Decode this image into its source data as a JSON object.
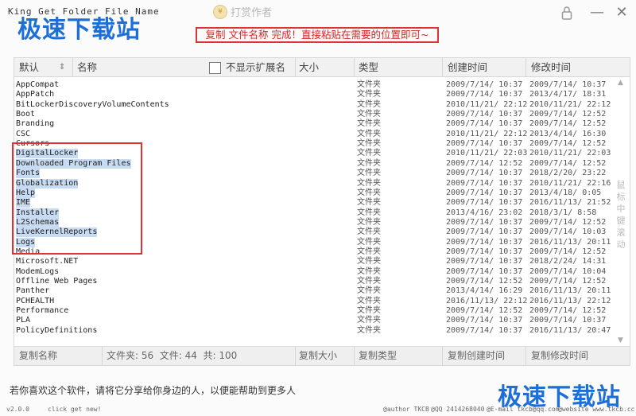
{
  "window": {
    "title": "King Get Folder File Name",
    "reward_label": "打赏作者",
    "watermark": "极速下载站",
    "notice": "复制 文件名称 完成！直接粘贴在需要的位置即可~"
  },
  "header": {
    "sort_label": "默认",
    "sort_icon": "⇕",
    "name": "名称",
    "hide_ext_label": "不显示扩展名",
    "size": "大小",
    "type": "类型",
    "created": "创建时间",
    "modified": "修改时间"
  },
  "rows": [
    {
      "name": "AppCompat",
      "type": "文件夹",
      "created": "2009/7/14/ 10:37",
      "modified": "2009/7/14/ 10:37",
      "selected": false
    },
    {
      "name": "AppPatch",
      "type": "文件夹",
      "created": "2009/7/14/ 10:37",
      "modified": "2013/4/17/ 18:31",
      "selected": false
    },
    {
      "name": "BitLockerDiscoveryVolumeContents",
      "type": "文件夹",
      "created": "2010/11/21/ 22:12",
      "modified": "2010/11/21/ 22:12",
      "selected": false
    },
    {
      "name": "Boot",
      "type": "文件夹",
      "created": "2009/7/14/ 10:37",
      "modified": "2009/7/14/ 12:52",
      "selected": false
    },
    {
      "name": "Branding",
      "type": "文件夹",
      "created": "2009/7/14/ 10:37",
      "modified": "2009/7/14/ 12:52",
      "selected": false
    },
    {
      "name": "CSC",
      "type": "文件夹",
      "created": "2010/11/21/ 22:12",
      "modified": "2013/4/14/ 16:30",
      "selected": false
    },
    {
      "name": "Cursors",
      "type": "文件夹",
      "created": "2009/7/14/ 10:37",
      "modified": "2009/7/14/ 12:52",
      "selected": false
    },
    {
      "name": "DigitalLocker",
      "type": "文件夹",
      "created": "2010/11/21/ 22:03",
      "modified": "2010/11/21/ 22:03",
      "selected": true
    },
    {
      "name": "Downloaded Program Files",
      "type": "文件夹",
      "created": "2009/7/14/ 12:52",
      "modified": "2009/7/14/ 12:52",
      "selected": true
    },
    {
      "name": "Fonts",
      "type": "文件夹",
      "created": "2009/7/14/ 10:37",
      "modified": "2018/2/20/ 23:22",
      "selected": true
    },
    {
      "name": "Globalization",
      "type": "文件夹",
      "created": "2009/7/14/ 10:37",
      "modified": "2010/11/21/ 22:16",
      "selected": true
    },
    {
      "name": "Help",
      "type": "文件夹",
      "created": "2009/7/14/ 10:37",
      "modified": "2013/4/18/ 0:05",
      "selected": true
    },
    {
      "name": "IME",
      "type": "文件夹",
      "created": "2009/7/14/ 10:37",
      "modified": "2016/11/13/ 21:52",
      "selected": true
    },
    {
      "name": "Installer",
      "type": "文件夹",
      "created": "2013/4/16/ 23:02",
      "modified": "2018/3/1/ 8:58",
      "selected": true
    },
    {
      "name": "L2Schemas",
      "type": "文件夹",
      "created": "2009/7/14/ 10:37",
      "modified": "2009/7/14/ 12:52",
      "selected": true
    },
    {
      "name": "LiveKernelReports",
      "type": "文件夹",
      "created": "2009/7/14/ 10:37",
      "modified": "2009/7/14/ 10:03",
      "selected": true
    },
    {
      "name": "Logs",
      "type": "文件夹",
      "created": "2009/7/14/ 10:37",
      "modified": "2016/11/13/ 20:11",
      "selected": true
    },
    {
      "name": "Media",
      "type": "文件夹",
      "created": "2009/7/14/ 10:37",
      "modified": "2009/7/14/ 12:52",
      "selected": false
    },
    {
      "name": "Microsoft.NET",
      "type": "文件夹",
      "created": "2009/7/14/ 10:37",
      "modified": "2018/2/24/ 14:31",
      "selected": false
    },
    {
      "name": "ModemLogs",
      "type": "文件夹",
      "created": "2009/7/14/ 10:37",
      "modified": "2009/7/14/ 10:04",
      "selected": false
    },
    {
      "name": "Offline Web Pages",
      "type": "文件夹",
      "created": "2009/7/14/ 12:52",
      "modified": "2009/7/14/ 12:52",
      "selected": false
    },
    {
      "name": "Panther",
      "type": "文件夹",
      "created": "2013/4/14/ 16:29",
      "modified": "2016/11/13/ 20:11",
      "selected": false
    },
    {
      "name": "PCHEALTH",
      "type": "文件夹",
      "created": "2016/11/13/ 22:12",
      "modified": "2016/11/13/ 22:12",
      "selected": false
    },
    {
      "name": "Performance",
      "type": "文件夹",
      "created": "2009/7/14/ 12:52",
      "modified": "2009/7/14/ 12:52",
      "selected": false
    },
    {
      "name": "PLA",
      "type": "文件夹",
      "created": "2009/7/14/ 10:37",
      "modified": "2009/7/14/ 10:37",
      "selected": false
    },
    {
      "name": "PolicyDefinitions",
      "type": "文件夹",
      "created": "2009/7/14/ 10:37",
      "modified": "2016/11/13/ 20:47",
      "selected": false
    }
  ],
  "scroll_hint": "鼠标中键滚动",
  "footer": {
    "copy_name": "复制名称",
    "folder_count": "文件夹: 56  文件: 44  共: 100",
    "copy_size": "复制大小",
    "copy_type": "复制类型",
    "copy_created": "复制创建时间",
    "copy_modified": "复制修改时间"
  },
  "share_text": "若你喜欢这个软件，请将它分享给你身边的人，以便能帮助到更多人",
  "status": {
    "version": "v2.0.0",
    "click": "click get new!",
    "author": "@author TKCB",
    "qq": "@QQ 2414268040",
    "email": "@E-mail tkcb@qq.com",
    "website": "@website www.tkcb.cc"
  },
  "colors": {
    "accent_red": "#dd3333",
    "watermark_blue": "#1d6fd8",
    "selection": "#c7dbf2"
  },
  "icons": [
    "coin-icon",
    "lock-icon",
    "minimize-icon",
    "close-icon",
    "sort-icon",
    "scroll-up-icon",
    "scroll-down-icon"
  ]
}
